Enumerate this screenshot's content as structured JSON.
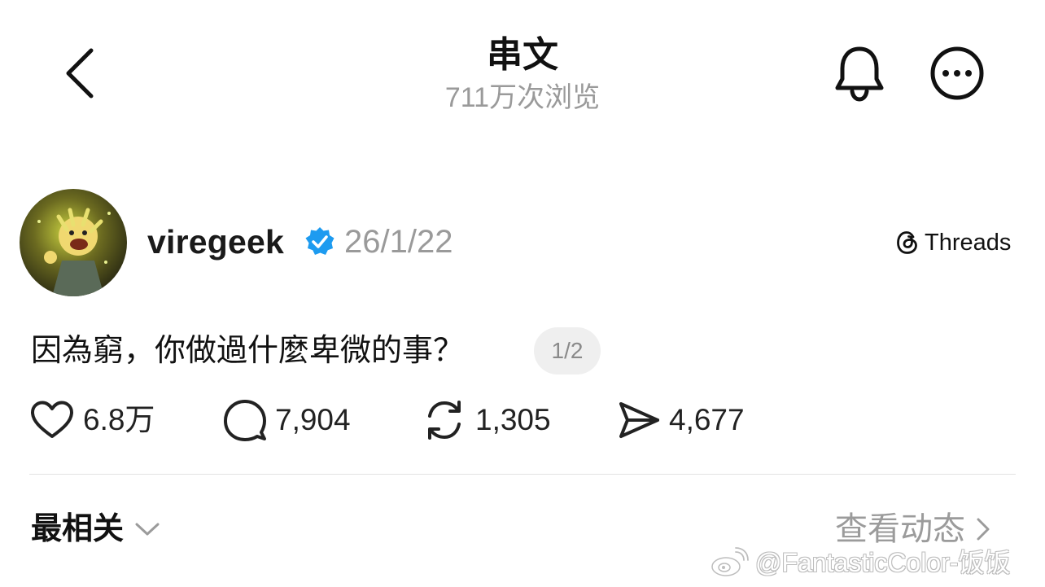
{
  "header": {
    "title": "串文",
    "views": "711万次浏览"
  },
  "post": {
    "username": "viregeek",
    "date": "26/1/22",
    "platform": "Threads",
    "text": "因為窮，你做過什麼卑微的事？",
    "page_indicator": "1/2"
  },
  "actions": {
    "likes": "6.8万",
    "comments": "7,904",
    "reposts": "1,305",
    "shares": "4,677"
  },
  "footer": {
    "sort_label": "最相关",
    "activity_label": "查看动态"
  },
  "watermark": "@FantasticColor-饭饭",
  "icons": [
    "back-icon",
    "bell-icon",
    "more-icon",
    "verified-icon",
    "threads-logo-icon",
    "heart-icon",
    "comment-icon",
    "repost-icon",
    "share-icon",
    "chevron-down-icon",
    "chevron-right-icon",
    "weibo-icon"
  ],
  "colors": {
    "text": "#111111",
    "muted": "#9a9a9a",
    "verified": "#1d9bf0",
    "chip_bg": "#efefef"
  }
}
